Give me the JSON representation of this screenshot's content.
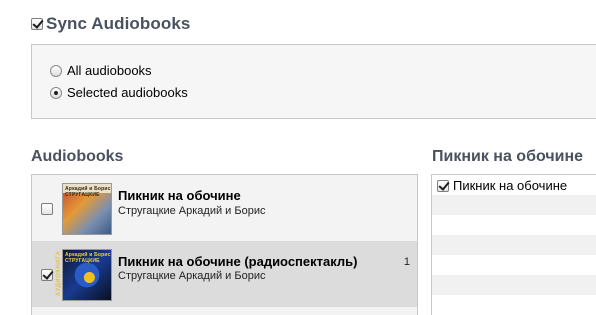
{
  "sync": {
    "title": "Sync Audiobooks",
    "checked": true
  },
  "options": [
    {
      "label": "All audiobooks",
      "selected": false
    },
    {
      "label": "Selected audiobooks",
      "selected": true
    }
  ],
  "audiobooks": {
    "section_title": "Audiobooks",
    "items": [
      {
        "title": "Пикник на обочине",
        "author": "Стругацкие Аркадий и Борис",
        "count": "",
        "checked": false,
        "cover_text": "Аркадий и Борис СТРУГАЦКИЕ"
      },
      {
        "title": "Пикник на обочине (радиоспектакль)",
        "author": "Стругацкие Аркадий и Борис",
        "count": "1",
        "checked": true,
        "cover_text": "Аркадий и Борис СТРУГАЦКИЕ",
        "cover_side": "АУДИОКНИГА"
      }
    ]
  },
  "playlist": {
    "section_title": "Пикник на обочине",
    "items": [
      {
        "label": "Пикник на обочине",
        "checked": true
      }
    ]
  }
}
